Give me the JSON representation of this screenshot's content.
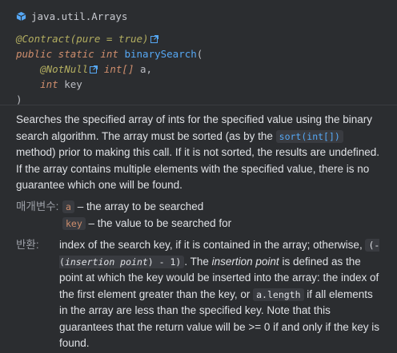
{
  "header": {
    "package": "java.util.Arrays",
    "annotation_line": "@Contract(pure = true)",
    "modifiers": "public static int",
    "method_name": "binarySearch",
    "open_paren": "(",
    "param1_annotation": "@NotNull",
    "param1_type": "int[]",
    "param1_name": "a,",
    "param2_type": "int",
    "param2_name": "key",
    "close_paren": ")"
  },
  "description": {
    "part1": "Searches the specified array of ints for the specified value using the binary search algorithm. The array must be sorted (as by the ",
    "link_code": "sort(int[])",
    "part2": " method) prior to making this call. If it is not sorted, the results are undefined. If the array contains multiple elements with the specified value, there is no guarantee which one will be found."
  },
  "params": {
    "label": "매개변수:",
    "items": [
      {
        "name": "a",
        "text": " – the array to be searched"
      },
      {
        "name": "key",
        "text": " – the value to be searched for"
      }
    ]
  },
  "returns": {
    "label": "반환:",
    "text1": "index of the search key, if it is contained in the array; otherwise, ",
    "code_open": "(-(",
    "code_em": "insertion point",
    "code_close": ") - 1)",
    "text2": ". The ",
    "em1": "insertion point",
    "text3": " is defined as the point at which the key would be inserted into the array: the index of the first element greater than the key, or ",
    "code2": "a.length",
    "text4": " if all elements in the array are less than the specified key. Note that this guarantees that the return value will be >= 0 if and only if the key is found."
  },
  "colors": {
    "background": "#2b2d30",
    "keyword": "#cf8e6d",
    "annotation": "#b3ae60",
    "method": "#56a8f5",
    "text": "#dfe1e5"
  }
}
